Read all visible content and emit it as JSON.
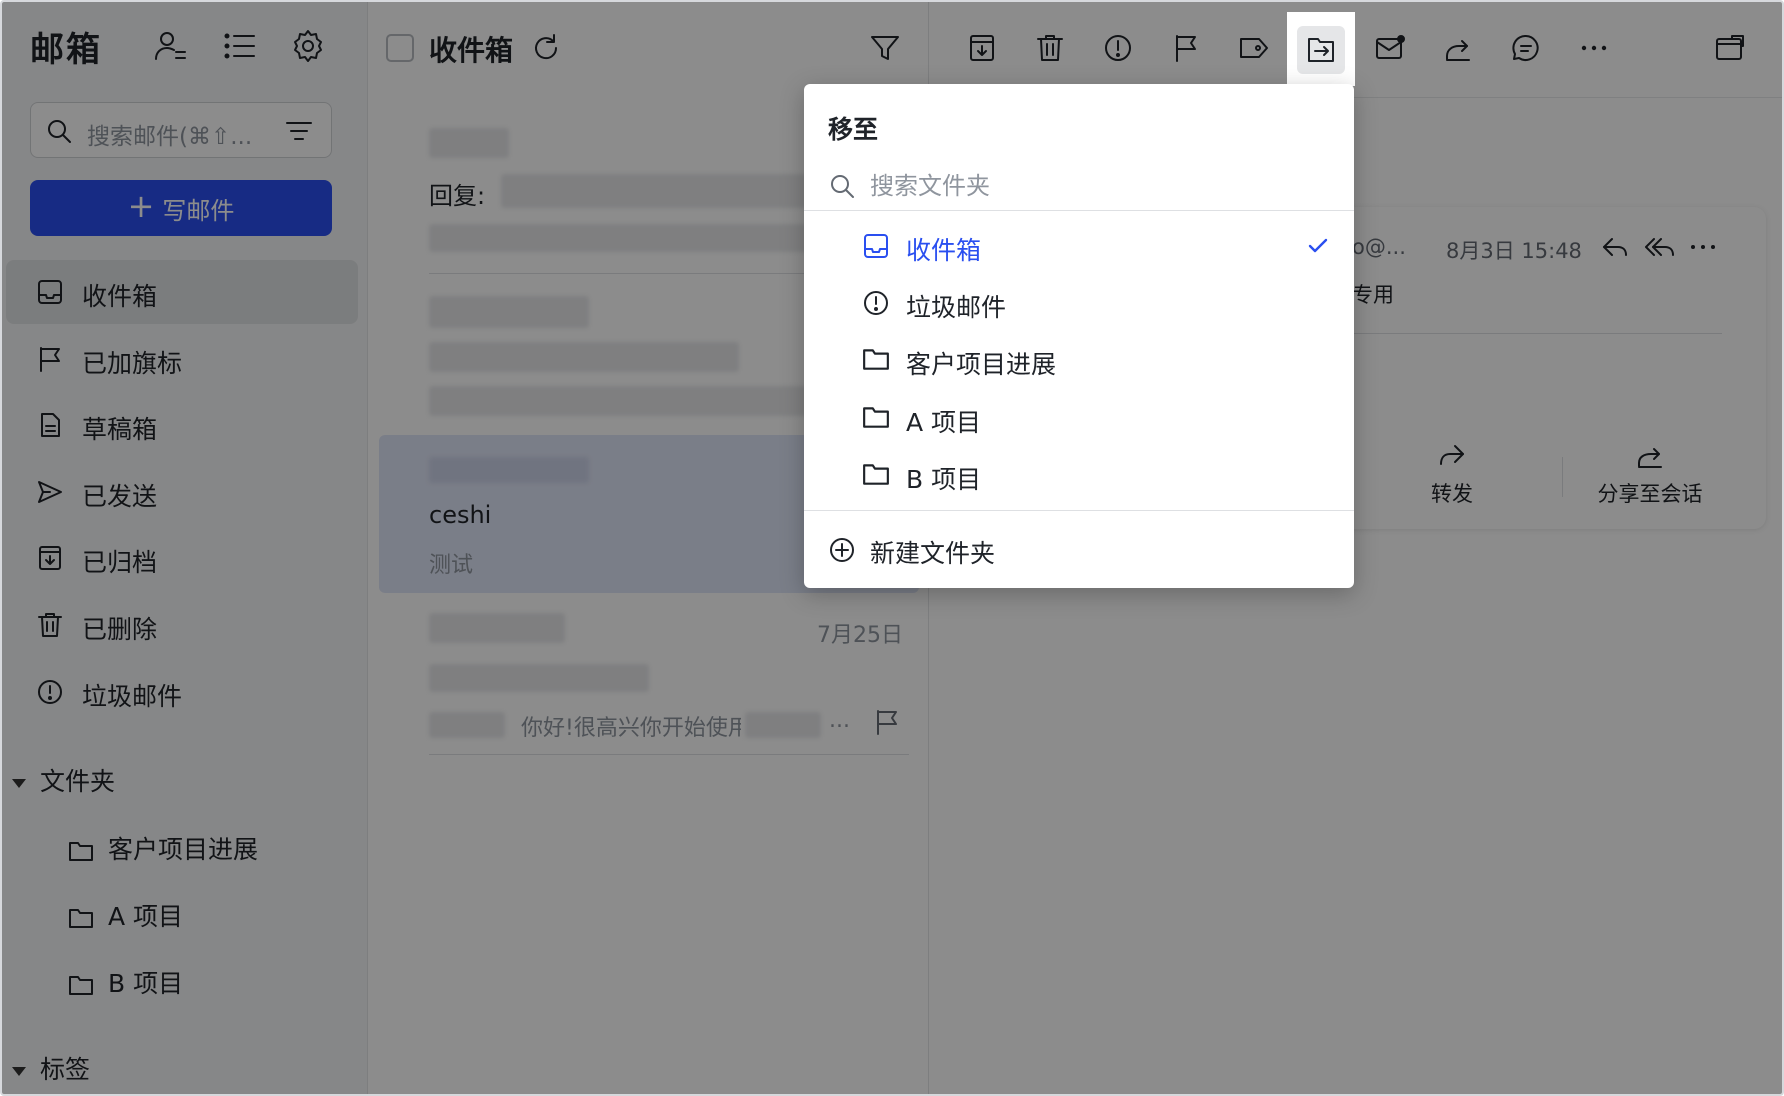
{
  "sidebar": {
    "title": "邮箱",
    "search_placeholder": "搜索邮件(⌘⇧...",
    "compose_label": "写邮件",
    "nav": [
      {
        "label": "收件箱",
        "icon": "inbox-icon",
        "active": true
      },
      {
        "label": "已加旗标",
        "icon": "flag-icon"
      },
      {
        "label": "草稿箱",
        "icon": "draft-icon"
      },
      {
        "label": "已发送",
        "icon": "sent-icon"
      },
      {
        "label": "已归档",
        "icon": "archive-icon"
      },
      {
        "label": "已删除",
        "icon": "trash-icon"
      },
      {
        "label": "垃圾邮件",
        "icon": "spam-icon"
      }
    ],
    "folders_header": "文件夹",
    "folders": [
      "客户项目进展",
      "A 项目",
      "B 项目"
    ],
    "labels_header": "标签"
  },
  "mail_list": {
    "title": "收件箱",
    "items": [
      {
        "prefix": "回复:"
      },
      {},
      {
        "sender": "ceshi",
        "preview": "测试",
        "selected": true
      },
      {
        "date": "7月25日",
        "preview": "你好!很高兴你开始使用",
        "ellipsis": "..."
      }
    ]
  },
  "reader": {
    "sender_partial": "o@...",
    "date": "8月3日 15:48",
    "subject_partial": "专用",
    "actions": [
      {
        "label": "转发",
        "icon": "forward-icon"
      },
      {
        "label": "分享至会话",
        "icon": "share-icon"
      }
    ]
  },
  "move_menu": {
    "title": "移至",
    "search_placeholder": "搜索文件夹",
    "items": [
      {
        "label": "收件箱",
        "icon": "inbox-icon",
        "selected": true
      },
      {
        "label": "垃圾邮件",
        "icon": "spam-icon"
      },
      {
        "label": "客户项目进展",
        "icon": "folder-icon"
      },
      {
        "label": "A 项目",
        "icon": "folder-icon"
      },
      {
        "label": "B 项目",
        "icon": "folder-icon"
      }
    ],
    "new_folder_label": "新建文件夹"
  },
  "colors": {
    "accent": "#2a4ff0",
    "overlay": "rgba(0,0,0,0.45)"
  }
}
